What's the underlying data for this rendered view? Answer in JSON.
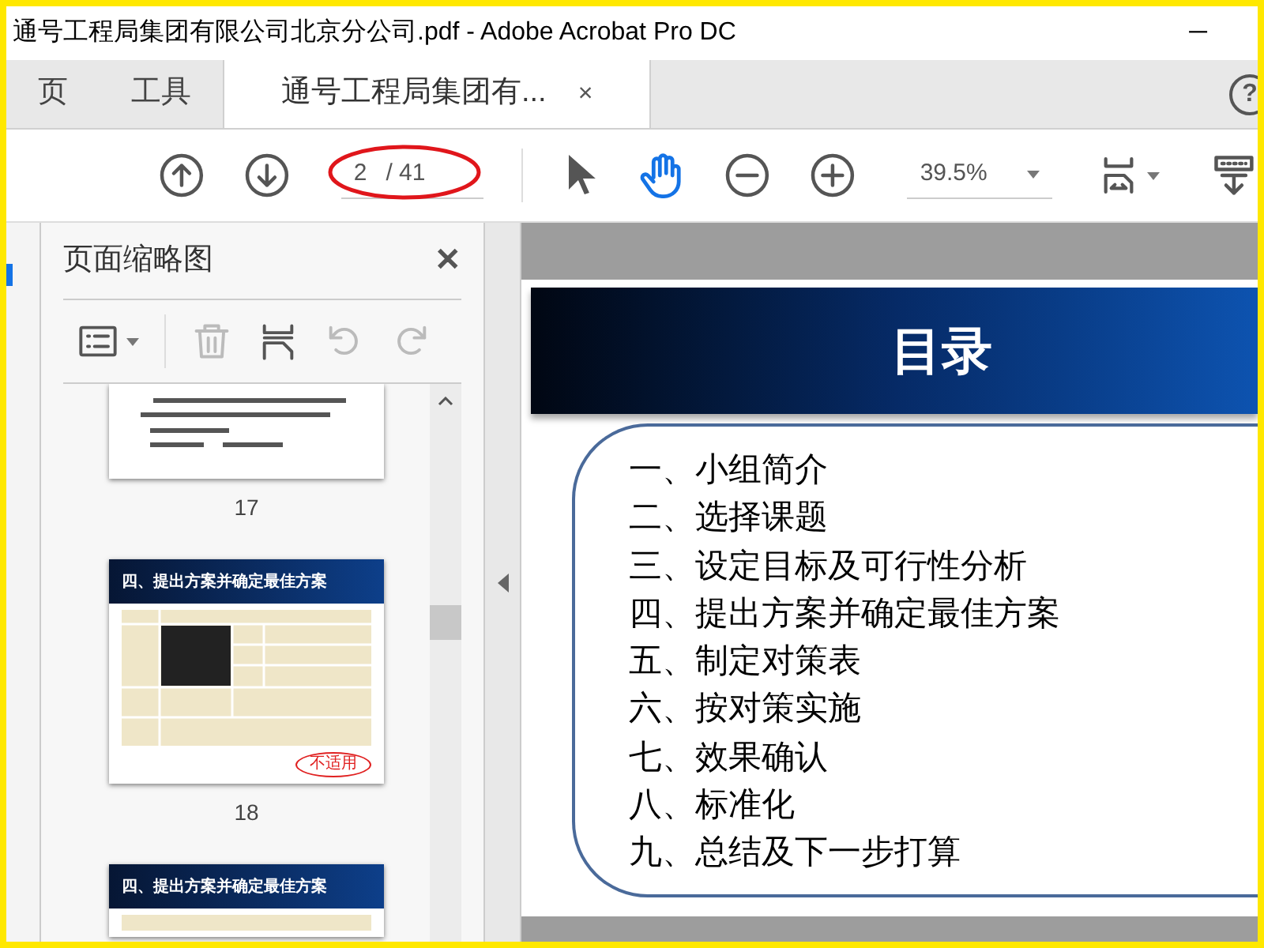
{
  "window": {
    "title": "通号工程局集团有限公司北京分公司.pdf - Adobe Acrobat Pro DC",
    "minimize": "─"
  },
  "tabs": [
    {
      "label": "页",
      "selected": false
    },
    {
      "label": "工具",
      "selected": false
    },
    {
      "label": "通号工程局集团有...",
      "selected": true,
      "close": "×"
    }
  ],
  "help": "?",
  "toolbar": {
    "page_current": "2",
    "page_total": "/ 41",
    "zoom": "39.5%",
    "tools": [
      {
        "kind": "select",
        "selected": false
      },
      {
        "kind": "hand",
        "selected": true
      }
    ]
  },
  "panel": {
    "title": "页面缩略图",
    "close": "✕",
    "thumbnails": [
      {
        "kind": "text",
        "label": "17",
        "selected": false
      },
      {
        "kind": "slide",
        "label": "18",
        "title": "四、提出方案并确定最佳方案",
        "selected": false,
        "stamp": "不适用"
      },
      {
        "kind": "slide",
        "title": "四、提出方案并确定最佳方案",
        "selected": false
      }
    ]
  },
  "page": {
    "title": "目录",
    "items": [
      "一、小组简介",
      "二、选择课题",
      "三、设定目标及可行性分析",
      "四、提出方案并确定最佳方案",
      "五、制定对策表",
      "六、按对策实施",
      "七、效果确认",
      "八、标准化",
      "九、总结及下一步打算"
    ]
  }
}
